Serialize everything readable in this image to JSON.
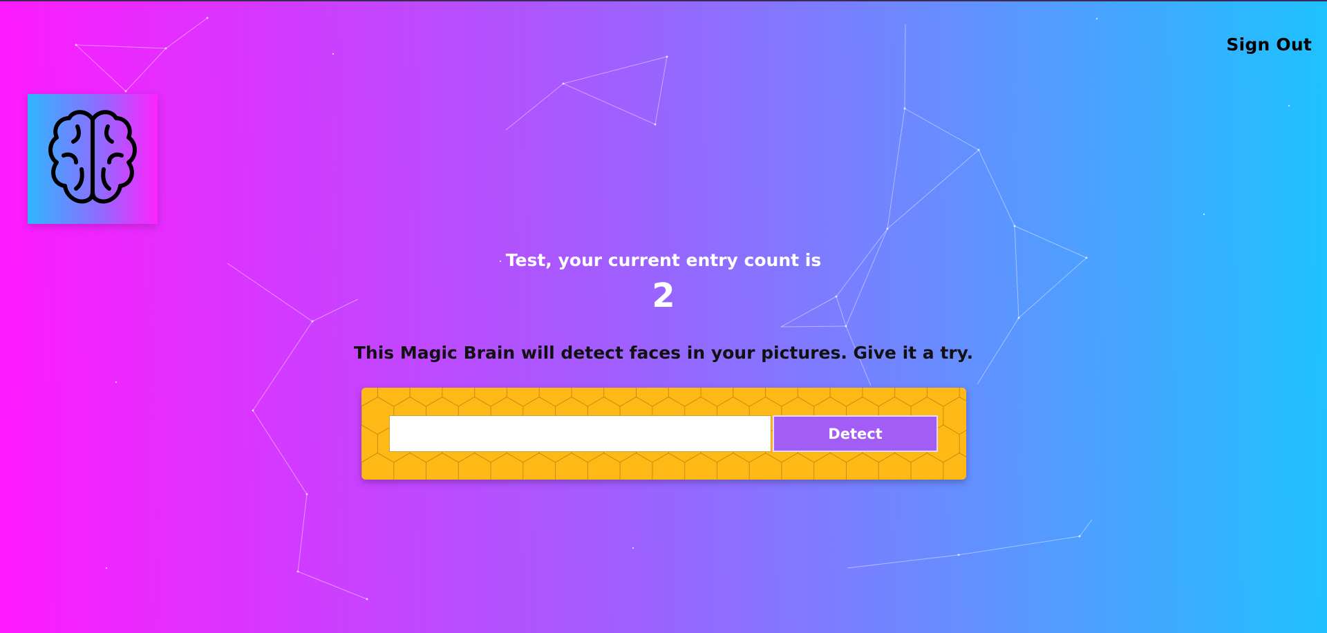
{
  "navigation": {
    "sign_out_label": "Sign Out"
  },
  "logo": {
    "icon": "brain-icon"
  },
  "rank": {
    "message": "Test, your current entry count is",
    "count": "2"
  },
  "tagline": "This Magic Brain will detect faces in your pictures. Give it a try.",
  "image_form": {
    "input_value": "",
    "detect_label": "Detect"
  },
  "colors": {
    "gradient_start": "#ff1aff",
    "gradient_end": "#1ec2ff",
    "panel_background": "#ffb916",
    "button_background": "#a25df5"
  }
}
